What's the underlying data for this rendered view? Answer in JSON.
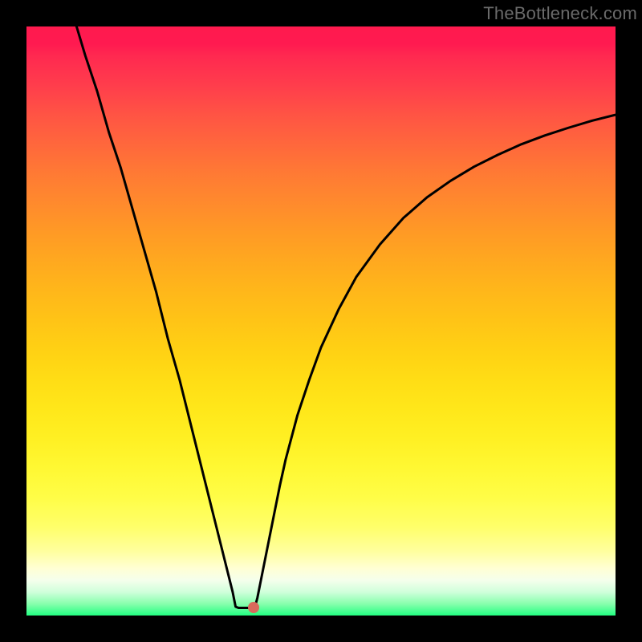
{
  "attribution": "TheBottleneck.com",
  "chart_data": {
    "type": "line",
    "title": "",
    "xlabel": "",
    "ylabel": "",
    "ylim": [
      0,
      100
    ],
    "xlim": [
      0,
      100
    ],
    "curve": [
      {
        "x": 8.5,
        "y": 100
      },
      {
        "x": 10,
        "y": 95
      },
      {
        "x": 12,
        "y": 89
      },
      {
        "x": 14,
        "y": 82
      },
      {
        "x": 16,
        "y": 76
      },
      {
        "x": 18,
        "y": 69
      },
      {
        "x": 20,
        "y": 62
      },
      {
        "x": 22,
        "y": 55
      },
      {
        "x": 24,
        "y": 47
      },
      {
        "x": 26,
        "y": 40
      },
      {
        "x": 28,
        "y": 32
      },
      {
        "x": 30,
        "y": 24
      },
      {
        "x": 32,
        "y": 16
      },
      {
        "x": 33,
        "y": 12
      },
      {
        "x": 34,
        "y": 8
      },
      {
        "x": 35,
        "y": 4
      },
      {
        "x": 35.5,
        "y": 1.5
      },
      {
        "x": 36,
        "y": 1.3
      },
      {
        "x": 37,
        "y": 1.3
      },
      {
        "x": 38,
        "y": 1.3
      },
      {
        "x": 38.8,
        "y": 1.5
      },
      {
        "x": 39.2,
        "y": 3
      },
      {
        "x": 40,
        "y": 7
      },
      {
        "x": 41,
        "y": 12
      },
      {
        "x": 42,
        "y": 17
      },
      {
        "x": 43,
        "y": 22
      },
      {
        "x": 44,
        "y": 26.5
      },
      {
        "x": 46,
        "y": 34
      },
      {
        "x": 48,
        "y": 40
      },
      {
        "x": 50,
        "y": 45.5
      },
      {
        "x": 53,
        "y": 52
      },
      {
        "x": 56,
        "y": 57.5
      },
      {
        "x": 60,
        "y": 63
      },
      {
        "x": 64,
        "y": 67.5
      },
      {
        "x": 68,
        "y": 71
      },
      {
        "x": 72,
        "y": 73.8
      },
      {
        "x": 76,
        "y": 76.2
      },
      {
        "x": 80,
        "y": 78.2
      },
      {
        "x": 84,
        "y": 80
      },
      {
        "x": 88,
        "y": 81.5
      },
      {
        "x": 92,
        "y": 82.8
      },
      {
        "x": 96,
        "y": 84
      },
      {
        "x": 100,
        "y": 85
      }
    ],
    "optimal_point": {
      "x": 38.5,
      "y": 1.3
    },
    "gradient": [
      {
        "pos": 0,
        "color": "#ff1a4e"
      },
      {
        "pos": 50,
        "color": "#ffc416"
      },
      {
        "pos": 85,
        "color": "#ffff6a"
      },
      {
        "pos": 100,
        "color": "#22ff81"
      }
    ],
    "description": "Bottleneck severity curve with rainbow gradient background; vertical axis is bottleneck percentage (0 at bottom, 100 at top), horizontal axis is hardware balance ratio. Minimum near x≈38."
  }
}
